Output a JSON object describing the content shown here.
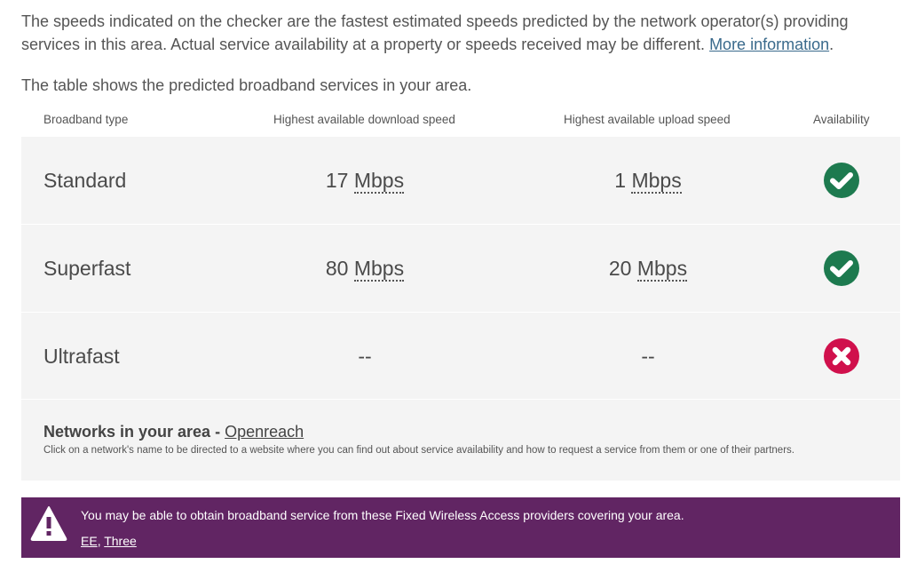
{
  "intro": {
    "text": "The speeds indicated on the checker are the fastest estimated speeds predicted by the network operator(s) providing services in this area. Actual service availability at a property or speeds received may be different.",
    "link_label": "More information",
    "trailing": "."
  },
  "lead": "The table shows the predicted broadband services in your area.",
  "table": {
    "headers": {
      "type": "Broadband type",
      "download": "Highest available download speed",
      "upload": "Highest available upload speed",
      "availability": "Availability"
    },
    "rows": [
      {
        "type": "Standard",
        "download_value": "17",
        "download_unit": "Mbps",
        "upload_value": "1",
        "upload_unit": "Mbps",
        "available": true,
        "icon": "check-circle-icon"
      },
      {
        "type": "Superfast",
        "download_value": "80",
        "download_unit": "Mbps",
        "upload_value": "20",
        "upload_unit": "Mbps",
        "available": true,
        "icon": "check-circle-icon"
      },
      {
        "type": "Ultrafast",
        "download_value": "--",
        "download_unit": "",
        "upload_value": "--",
        "upload_unit": "",
        "available": false,
        "icon": "cross-circle-icon"
      }
    ]
  },
  "networks": {
    "title": "Networks in your area -",
    "link_label": "Openreach",
    "note": "Click on a network's name to be directed to a website where you can find out about service availability and how to request a service from them or one of their partners."
  },
  "banner": {
    "icon": "warning-icon",
    "message": "You may be able to obtain broadband service from these Fixed Wireless Access providers covering your area.",
    "providers": [
      "EE",
      "Three"
    ],
    "separator": ", "
  },
  "colors": {
    "available": "#1d7a4f",
    "unavailable": "#d0104c",
    "banner_bg": "#612563",
    "row_bg": "#f4f4f4",
    "link": "#3a6a8c"
  }
}
